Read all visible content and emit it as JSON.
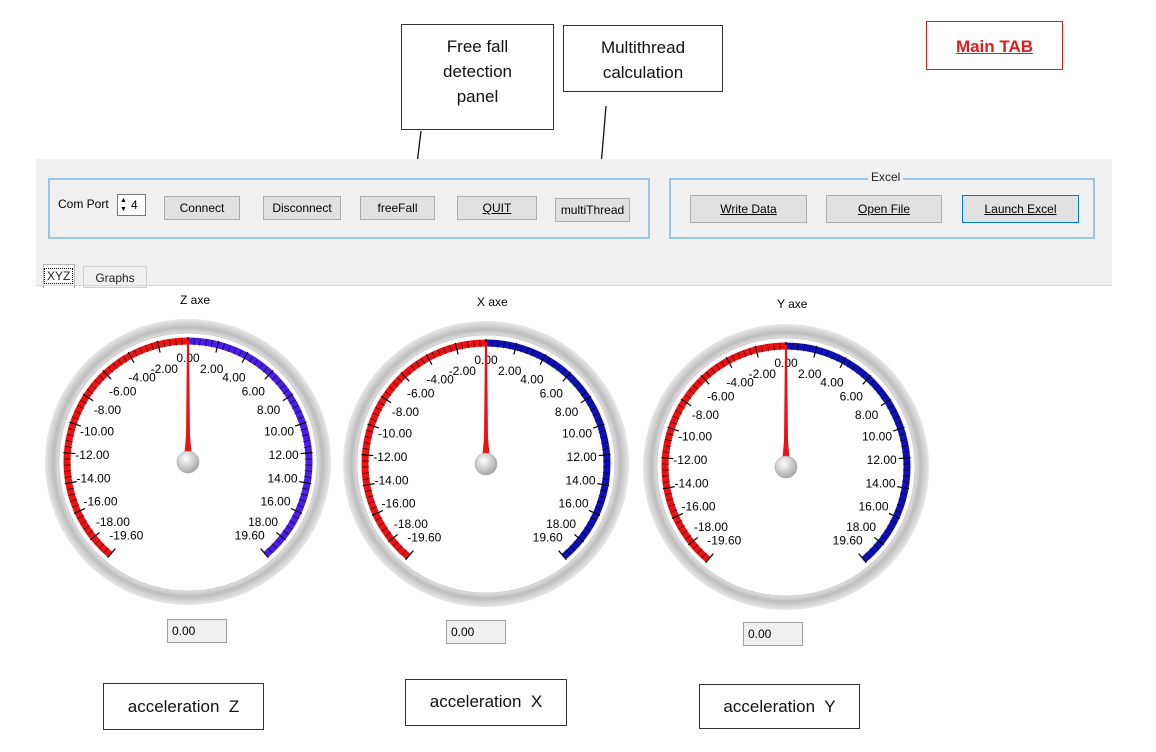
{
  "annotations": {
    "free_fall": [
      "Free fall",
      "detection",
      "panel"
    ],
    "multithread": [
      "Multithread",
      "calculation"
    ],
    "main_tab": "Main TAB"
  },
  "toolbar": {
    "com_port_label": "Com Port",
    "com_port_value": "4",
    "connect": "Connect",
    "disconnect": "Disconnect",
    "freefall": "freeFall",
    "quit": "QUIT",
    "multithread": "multiThread"
  },
  "excel": {
    "title": "Excel",
    "write_data": "Write Data",
    "open_file": "Open File",
    "launch_excel": "Launch Excel"
  },
  "tabs": [
    "XYZ",
    "Graphs"
  ],
  "gauges": [
    {
      "title": "Z axe",
      "value": 0.0,
      "readout": "0.00",
      "caption": "acceleration  Z",
      "positive_color": "#4a1ee8"
    },
    {
      "title": "X axe",
      "value": 0.0,
      "readout": "0.00",
      "caption": "acceleration  X",
      "positive_color": "#1010b8"
    },
    {
      "title": "Y axe",
      "value": 0.0,
      "readout": "0.00",
      "caption": "acceleration  Y",
      "positive_color": "#1010b8"
    }
  ],
  "gauge_scale": {
    "min": -19.6,
    "max": 19.6,
    "tick_labels": [
      "-19.60",
      "-18.00",
      "-16.00",
      "-14.00",
      "-12.00",
      "-10.00",
      "-8.00",
      "-6.00",
      "-4.00",
      "-2.00",
      "0.00",
      "2.00",
      "4.00",
      "6.00",
      "8.00",
      "10.00",
      "12.00",
      "14.00",
      "16.00",
      "18.00",
      "19.60"
    ],
    "negative_color": "#ee1111",
    "needle_color": "#ee1111"
  }
}
